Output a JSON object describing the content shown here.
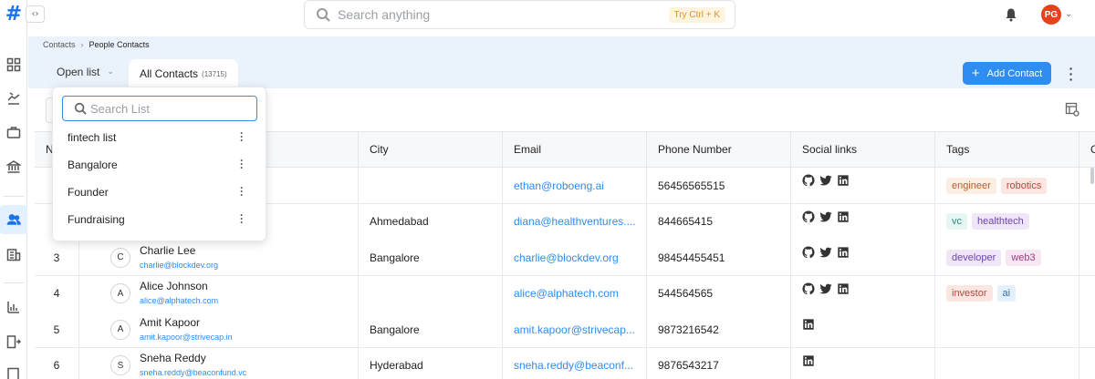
{
  "topbar": {
    "search_placeholder": "Search anything",
    "shortcut": "Try Ctrl + K",
    "avatar_initials": "PG"
  },
  "breadcrumb": [
    "Contacts",
    "People Contacts"
  ],
  "list_tabs": {
    "open_list": "Open list",
    "active_tab": "All Contacts",
    "active_count": "(13715)"
  },
  "actions": {
    "add_contact": "Add Contact"
  },
  "dropdown": {
    "search_placeholder": "Search List",
    "items": [
      "fintech list",
      "Bangalore",
      "Founder",
      "Fundraising"
    ]
  },
  "table": {
    "columns": [
      "N",
      "",
      "City",
      "Email",
      "Phone Number",
      "Social links",
      "Tags",
      "C"
    ],
    "rows": [
      {
        "num": "",
        "initial": "",
        "name": "",
        "name_email": "",
        "city": "",
        "email": "ethan@roboeng.ai",
        "phone": "56456565515",
        "social": [
          "github",
          "twitter",
          "linkedin"
        ],
        "tags": [
          "engineer",
          "robotics"
        ]
      },
      {
        "num": "",
        "initial": "",
        "name": "",
        "name_email": "",
        "city": "Ahmedabad",
        "email": "diana@healthventures....",
        "phone": "844665415",
        "social": [
          "github",
          "twitter",
          "linkedin"
        ],
        "tags": [
          "vc",
          "healthtech"
        ]
      },
      {
        "num": "3",
        "initial": "C",
        "name": "Charlie Lee",
        "name_email": "charlie@blockdev.org",
        "city": "Bangalore",
        "email": "charlie@blockdev.org",
        "phone": "98454455451",
        "social": [
          "github",
          "twitter",
          "linkedin"
        ],
        "tags": [
          "developer",
          "web3"
        ]
      },
      {
        "num": "4",
        "initial": "A",
        "name": "Alice Johnson",
        "name_email": "alice@alphatech.com",
        "city": "",
        "email": "alice@alphatech.com",
        "phone": "544564565",
        "social": [
          "github",
          "twitter",
          "linkedin"
        ],
        "tags": [
          "investor",
          "ai"
        ]
      },
      {
        "num": "5",
        "initial": "A",
        "name": "Amit Kapoor",
        "name_email": "amit.kapoor@strivecap.in",
        "city": "Bangalore",
        "email": "amit.kapoor@strivecap...",
        "phone": "9873216542",
        "social": [
          "linkedin"
        ],
        "tags": []
      },
      {
        "num": "6",
        "initial": "S",
        "name": "Sneha Reddy",
        "name_email": "sneha.reddy@beaconfund.vc",
        "city": "Hyderabad",
        "email": "sneha.reddy@beaconf...",
        "phone": "9876543217",
        "social": [
          "linkedin"
        ],
        "tags": []
      }
    ]
  },
  "tag_colors": {
    "engineer": {
      "bg": "#fdeee4",
      "fg": "#b5602b"
    },
    "robotics": {
      "bg": "#fbe6e2",
      "fg": "#b24a3b"
    },
    "vc": {
      "bg": "#e6f6f3",
      "fg": "#2a8f7e"
    },
    "healthtech": {
      "bg": "#efe7f8",
      "fg": "#6d46a8"
    },
    "developer": {
      "bg": "#efe7f8",
      "fg": "#6d46a8"
    },
    "web3": {
      "bg": "#f6e7f3",
      "fg": "#9c3d86"
    },
    "investor": {
      "bg": "#fbe6e2",
      "fg": "#b24a3b"
    },
    "ai": {
      "bg": "#e4f0fb",
      "fg": "#2f6fb0"
    }
  },
  "colors": {
    "accent": "#2f8cf0",
    "brand": "#1a73e8",
    "avatar": "#e8401c"
  }
}
